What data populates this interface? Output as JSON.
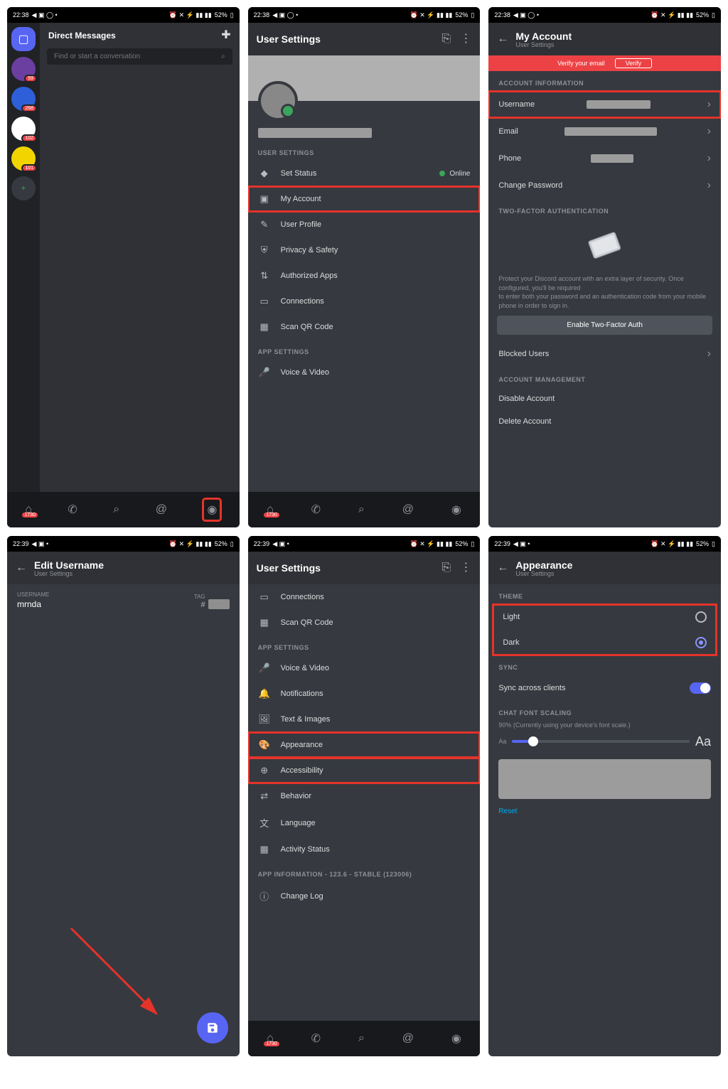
{
  "status": {
    "time1": "22:38",
    "time2": "22:39",
    "battery": "52%"
  },
  "s1": {
    "dm_title": "Direct Messages",
    "search_placeholder": "Find or start a conversation",
    "servers": [
      {
        "color": "#5865f2",
        "selected": true
      },
      {
        "color": "#6b3fa0",
        "badge": "59"
      },
      {
        "color": "#2e5fd8",
        "badge": "268"
      },
      {
        "color": "#ffffff",
        "badge": "102"
      },
      {
        "color": "#f2d500",
        "badge": "101"
      },
      {
        "color": "#36393f",
        "add": true
      }
    ],
    "nav_badge": "1730"
  },
  "s2": {
    "title": "User Settings",
    "sections": {
      "user": "USER SETTINGS",
      "app": "APP SETTINGS"
    },
    "status_row": {
      "label": "Set Status",
      "value": "Online"
    },
    "items_user": [
      "My Account",
      "User Profile",
      "Privacy & Safety",
      "Authorized Apps",
      "Connections",
      "Scan QR Code"
    ],
    "items_app": [
      "Voice & Video"
    ],
    "highlight": "My Account"
  },
  "s3": {
    "title": "My Account",
    "subtitle": "User Settings",
    "verify_text": "Verify your email",
    "verify_btn": "Verify",
    "sect_account": "ACCOUNT INFORMATION",
    "rows": {
      "username": "Username",
      "email": "Email",
      "phone": "Phone",
      "change_pw": "Change Password"
    },
    "sect_2fa": "TWO-FACTOR AUTHENTICATION",
    "desc1": "Protect your Discord account with an extra layer of security. Once configured, you'll be required",
    "desc2": "to enter both your password and an authentication code from your mobile phone in order to sign in.",
    "btn_2fa": "Enable Two-Factor Auth",
    "blocked": "Blocked Users",
    "sect_mgmt": "ACCOUNT MANAGEMENT",
    "disable": "Disable Account",
    "delete": "Delete Account"
  },
  "s4": {
    "title": "Edit Username",
    "subtitle": "User Settings",
    "field_label": "Username",
    "field_value": "mrnda",
    "tag_label": "TAG",
    "hash": "#"
  },
  "s5": {
    "title": "User Settings",
    "items_top": [
      "Connections",
      "Scan QR Code"
    ],
    "sect_app": "APP SETTINGS",
    "items_app": [
      "Voice & Video",
      "Notifications",
      "Text & Images",
      "Appearance",
      "Accessibility",
      "Behavior",
      "Language",
      "Activity Status"
    ],
    "highlight": [
      "Appearance",
      "Accessibility"
    ],
    "sect_info": "APP INFORMATION - 123.6 - STABLE (123006)",
    "items_info": [
      "Change Log"
    ]
  },
  "s6": {
    "title": "Appearance",
    "subtitle": "User Settings",
    "sect_theme": "THEME",
    "light": "Light",
    "dark": "Dark",
    "sect_sync": "SYNC",
    "sync": "Sync across clients",
    "sect_font": "CHAT FONT SCALING",
    "font_desc": "90% (Currently using your device's font scale.)",
    "aa_small": "Aa",
    "aa_large": "Aa",
    "reset": "Reset"
  },
  "icons": {
    "status": "◆",
    "account": "▣",
    "profile": "✎",
    "privacy": "⛨",
    "apps": "⇅",
    "conn": "▭",
    "qr": "▦",
    "voice": "🎤",
    "notif": "🔔",
    "text": "🖼",
    "appear": "🎨",
    "access": "⊕",
    "behav": "⇄",
    "lang": "文",
    "activity": "▦",
    "changelog": "ⓘ"
  }
}
